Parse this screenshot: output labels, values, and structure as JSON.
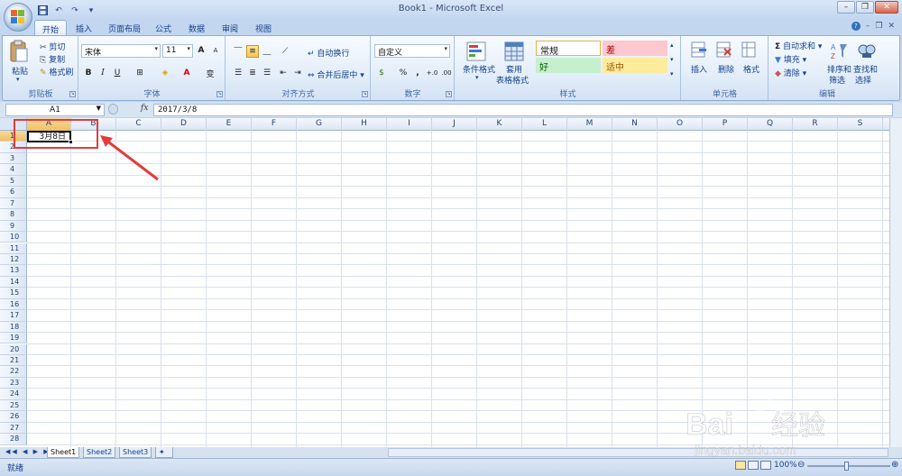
{
  "titlebar": {
    "title": "Book1 - Microsoft Excel",
    "qat_undo": "↶",
    "qat_redo": "↷"
  },
  "tabs": [
    "开始",
    "插入",
    "页面布局",
    "公式",
    "数据",
    "审阅",
    "视图"
  ],
  "active_tab": "开始",
  "ribbon": {
    "clipboard": {
      "paste": "粘贴",
      "cut": "剪切",
      "copy": "复制",
      "format_painter": "格式刷",
      "label": "剪贴板"
    },
    "font": {
      "font_name": "宋体",
      "font_size": "11",
      "bold": "B",
      "italic": "I",
      "underline": "U",
      "grow": "A",
      "shrink": "A",
      "phonetic": "变",
      "label": "字体"
    },
    "alignment": {
      "wrap_text": "自动换行",
      "merge_center": "合并后居中",
      "label": "对齐方式"
    },
    "number": {
      "format": "自定义",
      "percent": "%",
      "comma": ",",
      "label": "数字"
    },
    "styles": {
      "conditional": "条件格式",
      "table_format_1": "套用",
      "table_format_2": "表格格式",
      "normal": "常规",
      "bad": "差",
      "good": "好",
      "neutral": "适中",
      "label": "样式"
    },
    "cells": {
      "insert": "插入",
      "delete": "删除",
      "format": "格式",
      "label": "单元格"
    },
    "editing": {
      "autosum": "自动求和",
      "fill": "填充",
      "clear": "清除",
      "sort_1": "排序和",
      "sort_2": "筛选",
      "find_1": "查找和",
      "find_2": "选择",
      "label": "编辑"
    }
  },
  "formula_bar": {
    "name_box": "A1",
    "fx": "fx",
    "value": "2017/3/8"
  },
  "grid": {
    "columns": [
      "A",
      "B",
      "C",
      "D",
      "E",
      "F",
      "G",
      "H",
      "I",
      "J",
      "K",
      "L",
      "M",
      "N",
      "O",
      "P",
      "Q",
      "R",
      "S"
    ],
    "rows": [
      "1",
      "2",
      "3",
      "4",
      "5",
      "6",
      "7",
      "8",
      "9",
      "10",
      "11",
      "12",
      "13",
      "14",
      "15",
      "16",
      "17",
      "18",
      "19",
      "20",
      "21",
      "22",
      "23",
      "24",
      "25",
      "26",
      "27",
      "28"
    ],
    "selected_cell": "A1",
    "cell_A1": "3月8日"
  },
  "sheets": [
    "Sheet1",
    "Sheet2",
    "Sheet3"
  ],
  "active_sheet": "Sheet1",
  "status": {
    "ready": "就绪",
    "zoom": "100%"
  },
  "watermark": {
    "brand": "Bai",
    "brand_cn": "经验",
    "url": "jingyan.baidu.com"
  },
  "colors": {
    "accent": "#15428b",
    "annotation": "#e03c3c"
  }
}
